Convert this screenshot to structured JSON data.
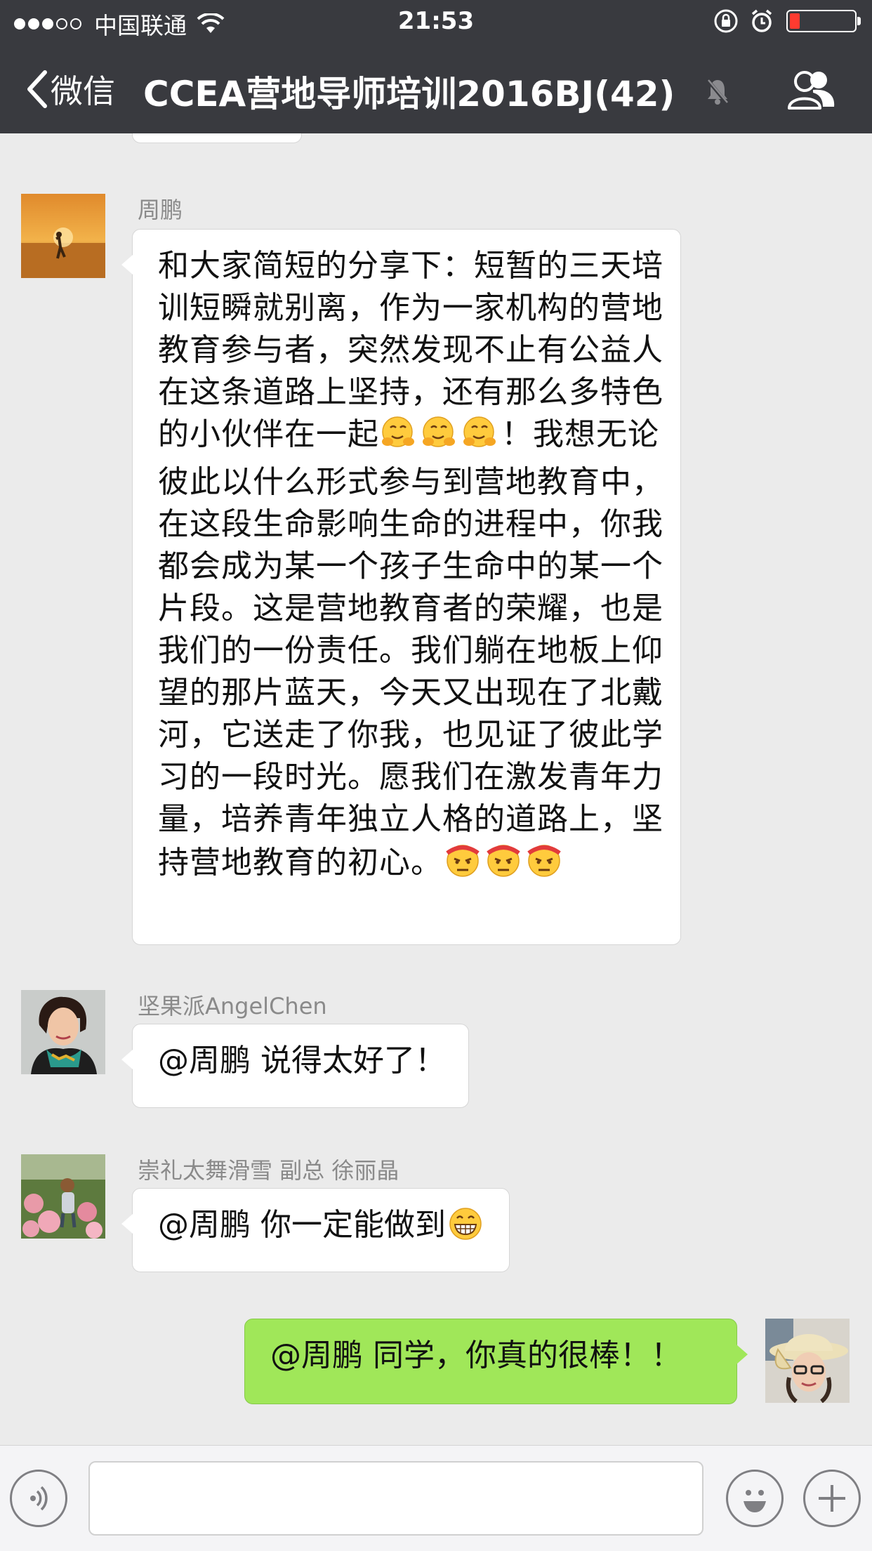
{
  "status_bar": {
    "carrier": "中国联通",
    "time": "21:53",
    "signal_strength": 3,
    "signal_max": 5,
    "battery_level": 0.15,
    "battery_color": "#ff3b30"
  },
  "nav": {
    "back_label": "微信",
    "title": "CCEA营地导师培训2016BJ(42)",
    "muted": true
  },
  "messages": [
    {
      "sender": "周鹏",
      "text": "和大家简短的分享下：短暂的三天培训短瞬就别离，作为一家机构的营地教育参与者，突然发现不止有公益人在这条道路上坚持，还有那么多特色的小伙伴在一起",
      "emoji_after_1": "hugging-face-emoji",
      "text_2": "！我想无论彼此以什么形式参与到营地教育中，在这段生命影响生命的进程中，你我都会成为某一个孩子生命中的某一个片段。这是营地教育者的荣耀，也是我们的一份责任。我们躺在地板上仰望的那片蓝天，今天又出现在了北戴河，它送走了你我，也见证了彼此学习的一段时光。愿我们在激发青年力量，培养青年独立人格的道路上，坚持营地教育的初心。",
      "emoji_after_2": "determined-face-emoji"
    },
    {
      "sender": "坚果派AngelChen",
      "text": "@周鹏 说得太好了！"
    },
    {
      "sender": "崇礼太舞滑雪 副总 徐丽晶",
      "text": "@周鹏 你一定能做到",
      "emoji_after": "grinning-face-emoji"
    },
    {
      "sender": "",
      "text": "@周鹏 同学，你真的很棒！！",
      "outgoing": true
    }
  ],
  "colors": {
    "navbar": "#393a3f",
    "chat_bg": "#ebebeb",
    "outgoing_bubble": "#a0e759",
    "incoming_bubble": "#ffffff"
  }
}
